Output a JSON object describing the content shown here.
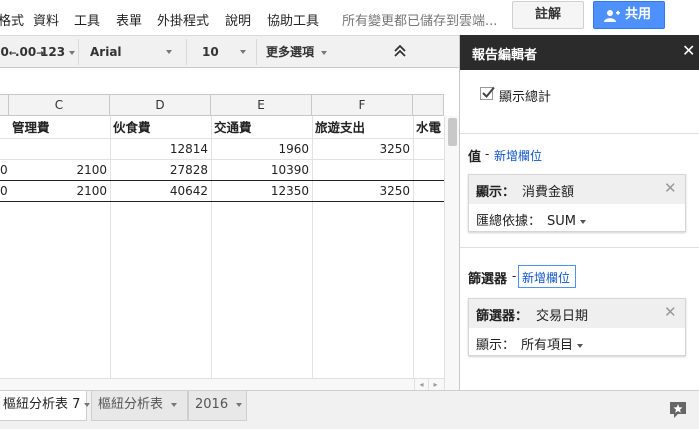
{
  "menu": {
    "items": [
      "格式",
      "資料",
      "工具",
      "表單",
      "外掛程式",
      "說明",
      "協助工具"
    ],
    "save_status": "所有變更都已儲存到雲端...",
    "comment_label": "註解",
    "share_label": "共用"
  },
  "toolbar": {
    "decimal_decrease": ".0",
    "decimal_increase": ".00",
    "more_formats": "123",
    "font": "Arial",
    "font_size": "10",
    "more_options": "更多選項",
    "collapse_icon": "double-chevron-up-icon"
  },
  "sheet": {
    "columns": [
      "C",
      "D",
      "E",
      "F"
    ],
    "header_row": [
      "管理費",
      "伙食費",
      "交通費",
      "旅遊支出",
      "水電"
    ],
    "rows": [
      {
        "b": "",
        "c": "",
        "d": "12814",
        "e": "1960",
        "f": "3250"
      },
      {
        "b": "0",
        "c": "2100",
        "d": "27828",
        "e": "10390",
        "f": ""
      },
      {
        "b": "0",
        "c": "2100",
        "d": "40642",
        "e": "12350",
        "f": "3250"
      }
    ]
  },
  "tabs": [
    "樞紐分析表 7",
    "樞紐分析表",
    "2016"
  ],
  "panel": {
    "title": "報告編輯者",
    "show_total_label": "顯示總計",
    "show_total_checked": true,
    "values_section": {
      "title": "值",
      "add_link": "新增欄位",
      "card": {
        "key": "顯示：",
        "value": "消費金額",
        "summarize_label": "匯總依據：",
        "summarize_value": "SUM"
      }
    },
    "filters_section": {
      "title": "篩選器",
      "add_link": "新增欄位",
      "card": {
        "key": "篩選器：",
        "value": "交易日期",
        "show_label": "顯示：",
        "show_value": "所有項目"
      }
    }
  },
  "colors": {
    "share_blue": "#4d90fe",
    "panel_header": "#2b2b2b",
    "link": "#1155cc"
  }
}
